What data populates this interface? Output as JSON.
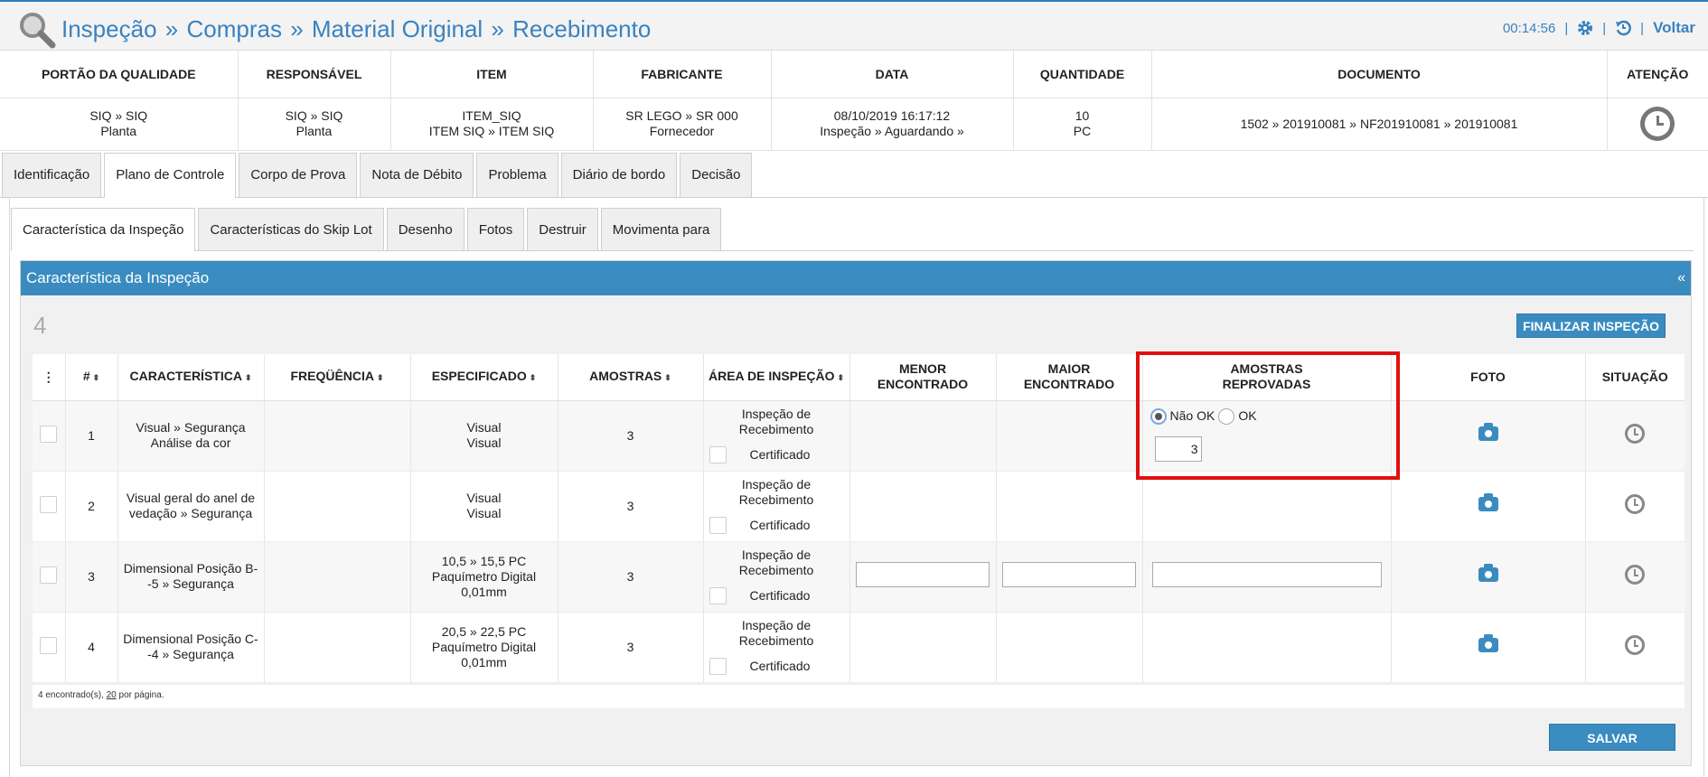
{
  "title": {
    "breadcrumb": [
      "Inspeção",
      "Compras",
      "Material Original",
      "Recebimento"
    ],
    "separator": "»",
    "time": "00:14:56",
    "back": "Voltar"
  },
  "info": {
    "headers": [
      "PORTÃO DA QUALIDADE",
      "RESPONSÁVEL",
      "ITEM",
      "FABRICANTE",
      "DATA",
      "QUANTIDADE",
      "DOCUMENTO",
      "ATENÇÃO"
    ],
    "values": {
      "portao": [
        "SIQ » SIQ",
        "Planta"
      ],
      "responsavel": [
        "SIQ » SIQ",
        "Planta"
      ],
      "item": [
        "ITEM_SIQ",
        "ITEM SIQ » ITEM SIQ"
      ],
      "fabricante": [
        "SR LEGO » SR 000",
        "Fornecedor"
      ],
      "data": [
        "08/10/2019 16:17:12",
        "Inspeção » Aguardando »"
      ],
      "quantidade": [
        "10",
        "PC"
      ],
      "documento": "1502 » 201910081 » NF201910081 » 201910081"
    }
  },
  "tabs": [
    "Identificação",
    "Plano de Controle",
    "Corpo de Prova",
    "Nota de Débito",
    "Problema",
    "Diário de bordo",
    "Decisão"
  ],
  "subtabs": [
    "Característica da Inspeção",
    "Características do Skip Lot",
    "Desenho",
    "Fotos",
    "Destruir",
    "Movimenta para"
  ],
  "panel": {
    "title": "Característica da Inspeção",
    "collapse": "«",
    "count": "4",
    "finalize": "FINALIZAR INSPEÇÃO"
  },
  "grid": {
    "headers": {
      "menu": "⋮",
      "num": "#",
      "caracteristica": "CARACTERÍSTICA",
      "frequencia": "FREQÜÊNCIA",
      "especificado": "ESPECIFICADO",
      "amostras": "AMOSTRAS",
      "area": "ÁREA DE INSPEÇÃO",
      "menor": [
        "MENOR",
        "ENCONTRADO"
      ],
      "maior": [
        "MAIOR",
        "ENCONTRADO"
      ],
      "reprovadas": [
        "AMOSTRAS",
        "REPROVADAS"
      ],
      "foto": "FOTO",
      "situacao": "SITUAÇÃO"
    },
    "rows": [
      {
        "num": "1",
        "car": [
          "Visual » Segurança",
          "Análise da cor"
        ],
        "esp": [
          "Visual",
          "Visual"
        ],
        "amostras": "3",
        "area": [
          "Inspeção de",
          "Recebimento"
        ],
        "cert": "Certificado"
      },
      {
        "num": "2",
        "car": [
          "Visual geral do anel de",
          "vedação » Segurança"
        ],
        "esp": [
          "Visual",
          "Visual"
        ],
        "amostras": "3",
        "area": [
          "Inspeção de",
          "Recebimento"
        ],
        "cert": "Certificado"
      },
      {
        "num": "3",
        "car": [
          "Dimensional Posição B-",
          "-5 » Segurança"
        ],
        "esp": [
          "10,5 » 15,5 PC",
          "Paquímetro Digital",
          "0,01mm"
        ],
        "amostras": "3",
        "area": [
          "Inspeção de",
          "Recebimento"
        ],
        "cert": "Certificado"
      },
      {
        "num": "4",
        "car": [
          "Dimensional Posição C-",
          "-4 » Segurança"
        ],
        "esp": [
          "20,5 » 22,5 PC",
          "Paquímetro Digital",
          "0,01mm"
        ],
        "amostras": "3",
        "area": [
          "Inspeção de",
          "Recebimento"
        ],
        "cert": "Certificado"
      }
    ],
    "reject": {
      "nao_ok": "Não OK",
      "ok": "OK",
      "value": "3"
    }
  },
  "footer": {
    "found": "4 encontrado(s), ",
    "per_page_num": "20",
    "per_page": " por página."
  },
  "save": "SALVAR"
}
